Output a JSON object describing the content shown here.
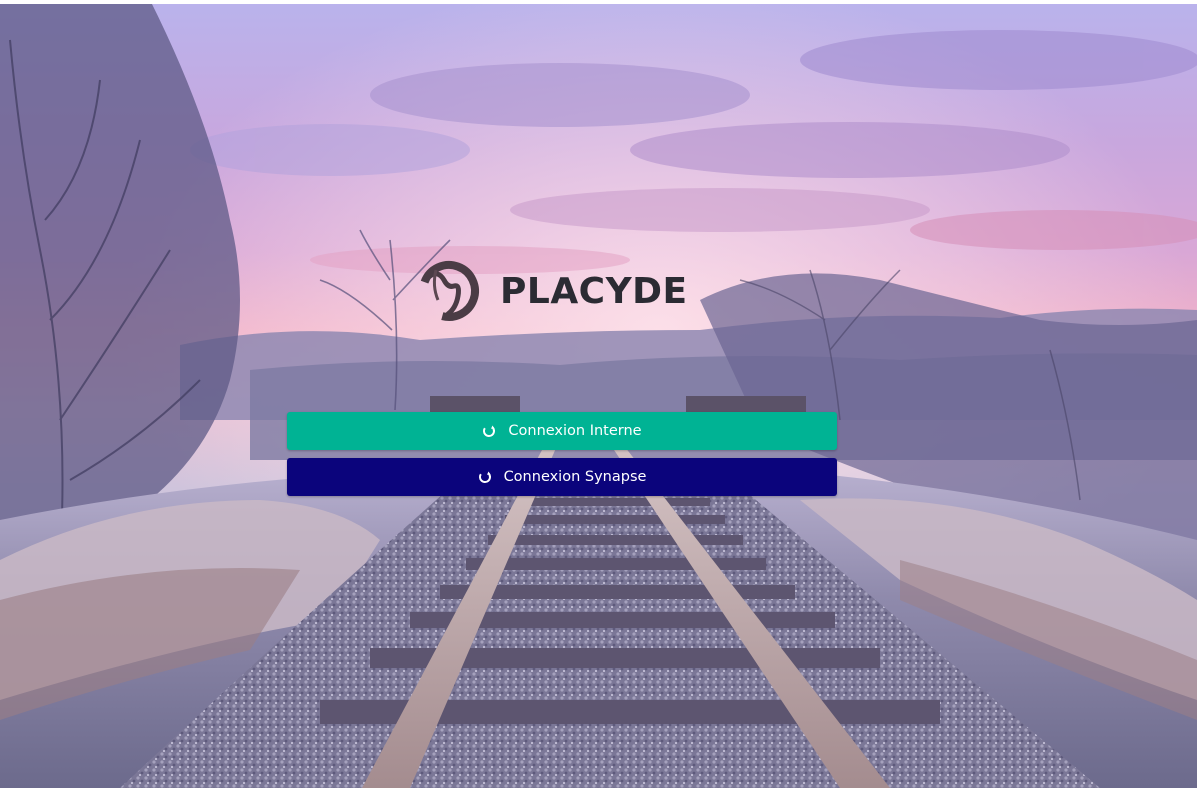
{
  "brand": {
    "name": "PLACYDE",
    "logo_icon": "placyde-logo-icon"
  },
  "login": {
    "internal_label": "Connexion Interne",
    "internal_icon": "refresh-icon",
    "synapse_label": "Connexion Synapse",
    "synapse_icon": "refresh-icon"
  },
  "colors": {
    "internal_button": "#00b394",
    "synapse_button": "#0b047c",
    "brand_text": "#2b2b33"
  },
  "background": {
    "scene": "frosted railway track at sunrise"
  }
}
